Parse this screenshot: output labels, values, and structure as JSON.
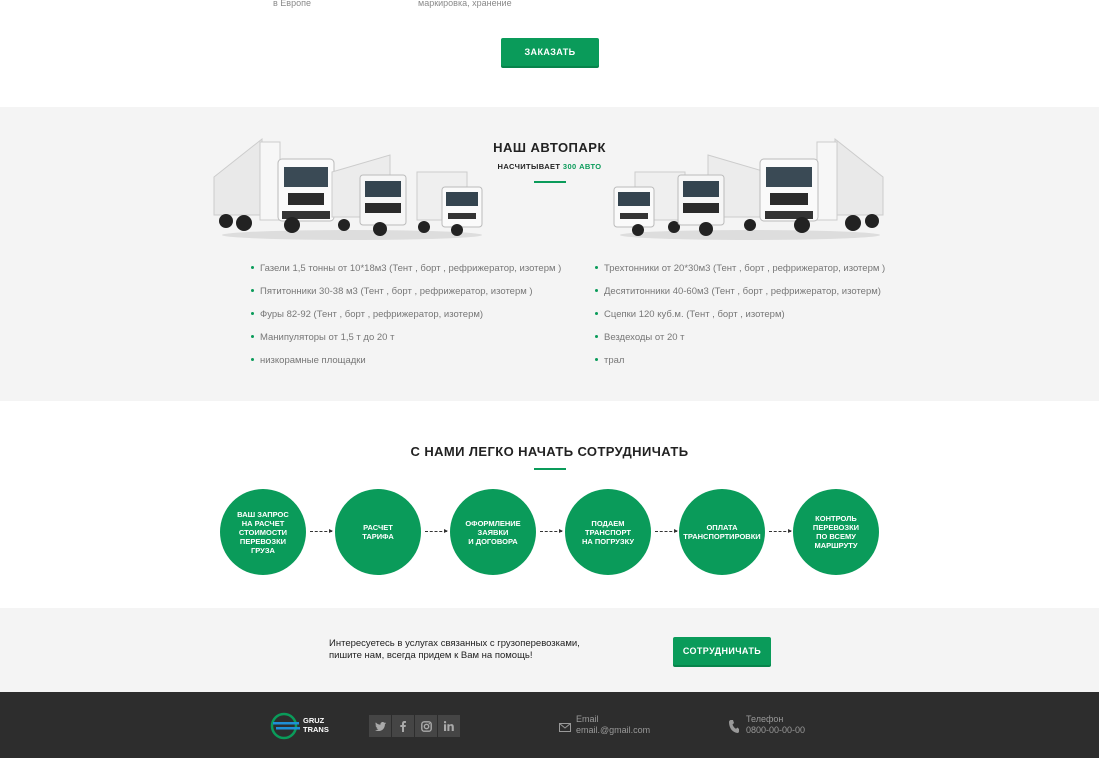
{
  "top": {
    "caption_left": "в Европе",
    "caption_right": "маркировка, хранение",
    "order_label": "ЗАКАЗАТЬ"
  },
  "fleet": {
    "title": "НАШ АВТОПАРК",
    "subtitle_prefix": "НАСЧИТЫВАЕТ",
    "subtitle_highlight": "300 АВТО",
    "left_items": [
      "Газели 1,5 тонны от 10*18м3 (Тент , борт , рефрижератор, изотерм )",
      "Пятитонники 30-38 м3 (Тент , борт , рефрижератор, изотерм )",
      "Фуры 82-92 (Тент , борт , рефрижератор, изотерм)",
      "Манипуляторы от 1,5 т до 20 т",
      "низкорамные площадки"
    ],
    "right_items": [
      "Трехтонники от 20*30м3 (Тент , борт , рефрижератор, изотерм )",
      "Десятитонники 40-60м3 (Тент , борт , рефрижератор, изотерм)",
      "Сцепки 120 куб.м. (Тент , борт , изотерм)",
      "Вездеходы от 20 т",
      "трал"
    ]
  },
  "steps": {
    "title": "С НАМИ ЛЕГКО НАЧАТЬ СОТРУДНИЧАТЬ",
    "items": [
      "ВАШ ЗАПРОС\nНА РАСЧЕТ\nСТОИМОСТИ\nПЕРЕВОЗКИ\nГРУЗА",
      "РАСЧЕТ\nТАРИФА",
      "ОФОРМЛЕНИЕ\nЗАЯВКИ\nИ ДОГОВОРА",
      "ПОДАЕМ\nТРАНСПОРТ\nНА ПОГРУЗКУ",
      "ОПЛАТА\nТРАНСПОРТИРОВКИ",
      "КОНТРОЛЬ\nПЕРЕВОЗКИ\nПО ВСЕМУ\nМАРШРУТУ"
    ]
  },
  "cta": {
    "text": "Интересуетесь в услугах связанных с  грузоперевозками,\nпишите нам, всегда придем к Вам на помощь!",
    "button_label": "СОТРУДНИЧАТЬ"
  },
  "footer": {
    "logo_line1": "GRUZ",
    "logo_line2": "TRANS",
    "socials": [
      "twitter-icon",
      "facebook-icon",
      "instagram-icon",
      "linkedin-icon"
    ],
    "email_label": "Email",
    "email_value": "email.@gmail.com",
    "phone_label": "Телефон",
    "phone_value": "0800-00-00-00"
  },
  "colors": {
    "accent": "#0a9b5a",
    "section_bg": "#f4f4f4",
    "footer_bg": "#2d2d2d"
  }
}
